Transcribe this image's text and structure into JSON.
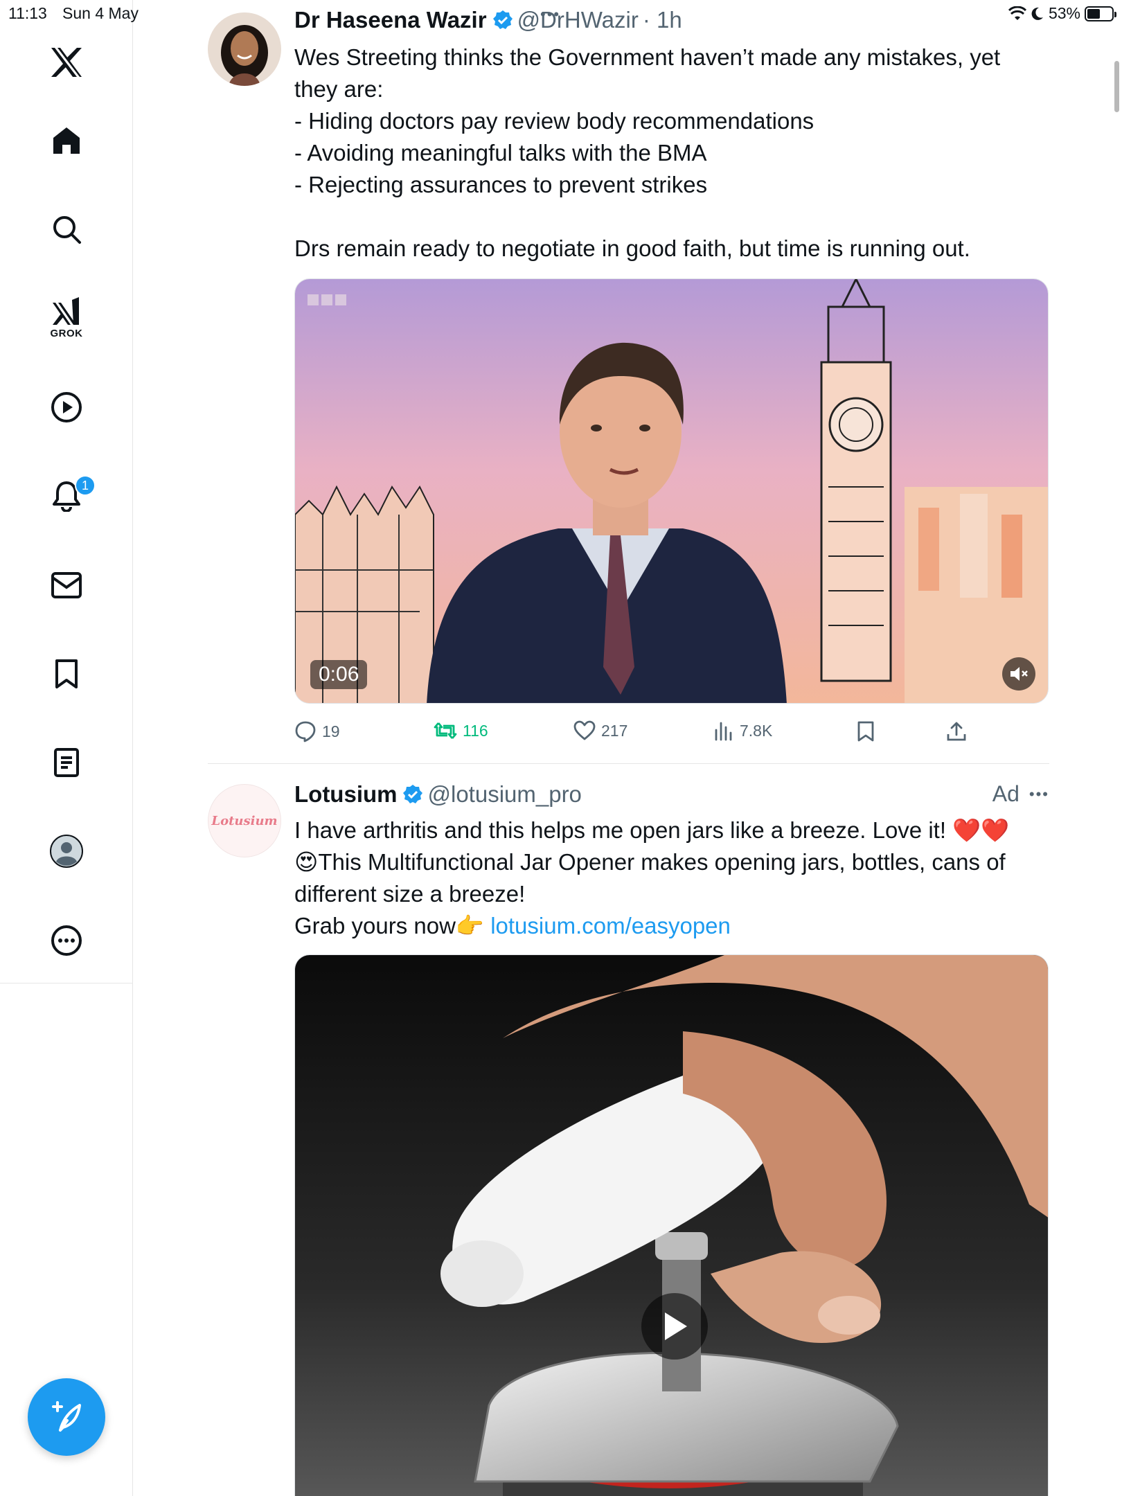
{
  "status_bar": {
    "time": "11:13",
    "date": "Sun 4 May",
    "battery": "53%",
    "battery_level": 0.53
  },
  "sidebar": {
    "logo": "x-logo-icon",
    "items": [
      {
        "name": "home",
        "icon": "home-icon"
      },
      {
        "name": "explore",
        "icon": "search-icon"
      },
      {
        "name": "grok",
        "icon": "grok-icon",
        "label": "GROK"
      },
      {
        "name": "videos",
        "icon": "play-icon"
      },
      {
        "name": "notifications",
        "icon": "bell-icon",
        "badge": "1"
      },
      {
        "name": "messages",
        "icon": "mail-icon"
      },
      {
        "name": "bookmarks",
        "icon": "bookmark-icon"
      },
      {
        "name": "articles",
        "icon": "article-icon"
      },
      {
        "name": "profile",
        "icon": "profile-icon"
      },
      {
        "name": "more",
        "icon": "more-icon"
      }
    ],
    "compose": "compose-icon"
  },
  "tweets": [
    {
      "name": "Dr Haseena Wazir",
      "handle": "@DrHWazir",
      "time": "· 1h",
      "text": "Wes Streeting thinks the Government haven’t made any mistakes, yet they are:\n- Hiding doctors pay review body recommendations\n- Avoiding meaningful talks with the BMA\n- Rejecting assurances to prevent strikes\n\nDrs remain ready to negotiate in good faith, but time is running out.",
      "video_time": "0:06",
      "replies": "19",
      "retweets": "116",
      "likes": "217",
      "views": "7.8K"
    },
    {
      "name": "Lotusium",
      "handle": "@lotusium_pro",
      "ad": "Ad",
      "avatar_text": "Lotusium",
      "text_line1": "I have arthritis and this helps me open jars like a breeze. Love it! ❤️❤️",
      "text_line2": "😍This Multifunctional Jar Opener makes opening jars, bottles, cans of different size a breeze!",
      "text_line3": "Grab yours now👉 ",
      "link": "lotusium.com/easyopen"
    }
  ],
  "colors": {
    "accent": "#1d9bf0",
    "retweet": "#00ba7c",
    "muted": "#536471"
  }
}
